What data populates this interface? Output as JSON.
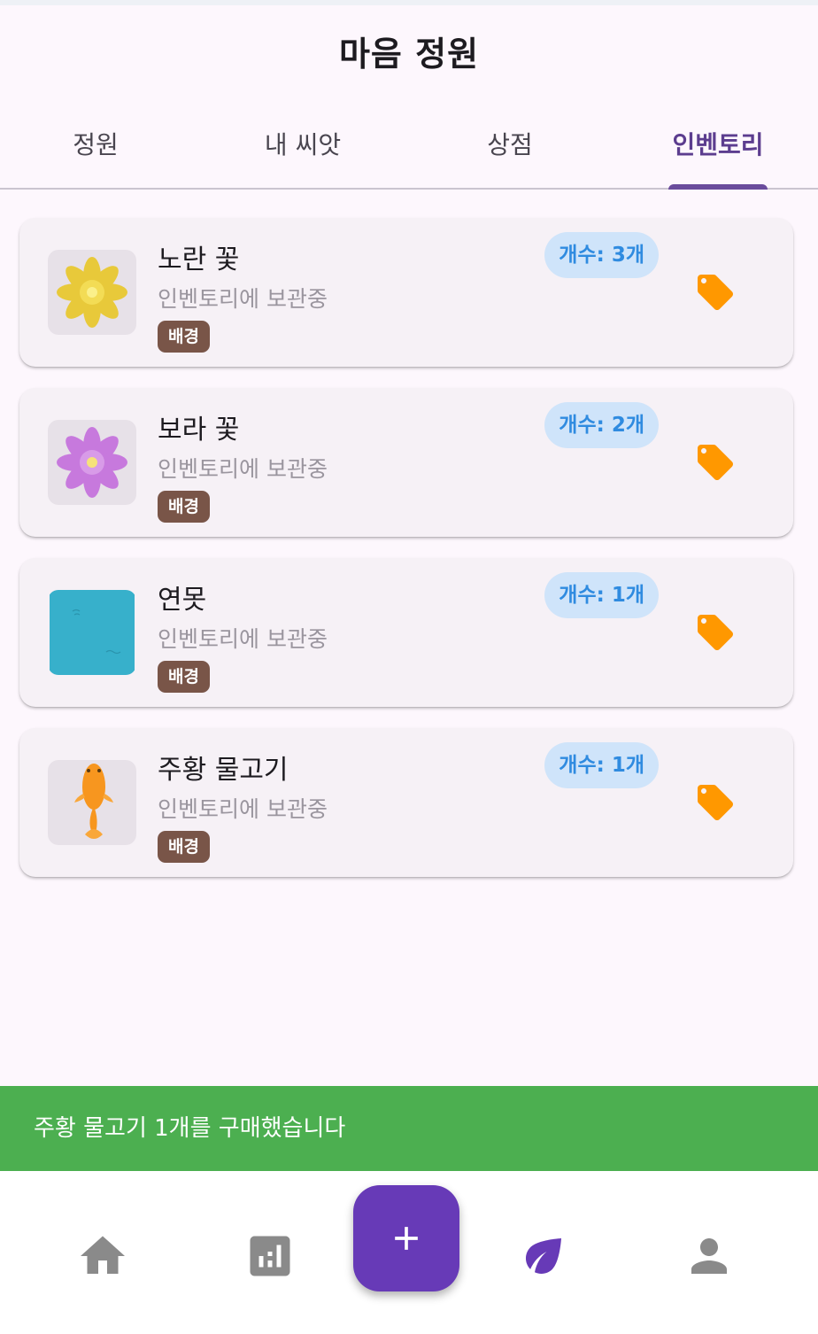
{
  "header": {
    "title": "마음 정원"
  },
  "tabs": [
    {
      "label": "정원"
    },
    {
      "label": "내 씨앗"
    },
    {
      "label": "상점"
    },
    {
      "label": "인벤토리"
    }
  ],
  "inventory": [
    {
      "name": "노란 꽃",
      "status": "인벤토리에 보관중",
      "category": "배경",
      "count": "개수: 3개",
      "icon": "yellow-flower-icon"
    },
    {
      "name": "보라 꽃",
      "status": "인벤토리에 보관중",
      "category": "배경",
      "count": "개수: 2개",
      "icon": "purple-flower-icon"
    },
    {
      "name": "연못",
      "status": "인벤토리에 보관중",
      "category": "배경",
      "count": "개수: 1개",
      "icon": "pond-icon"
    },
    {
      "name": "주황 물고기",
      "status": "인벤토리에 보관중",
      "category": "배경",
      "count": "개수: 1개",
      "icon": "orange-fish-icon"
    }
  ],
  "snackbar": {
    "message": "주황 물고기 1개를 구매했습니다"
  },
  "bottom_nav": {
    "items": [
      "home-icon",
      "chart-icon",
      "add-icon",
      "leaf-icon",
      "person-icon"
    ]
  },
  "colors": {
    "accent": "#673ab7",
    "tab_active": "#5c3d8f",
    "snackbar": "#4caf50",
    "category_chip": "#795548",
    "count_badge_bg": "#cfe4fa",
    "count_badge_text": "#2f8be0",
    "tag_icon": "#ff9800"
  }
}
